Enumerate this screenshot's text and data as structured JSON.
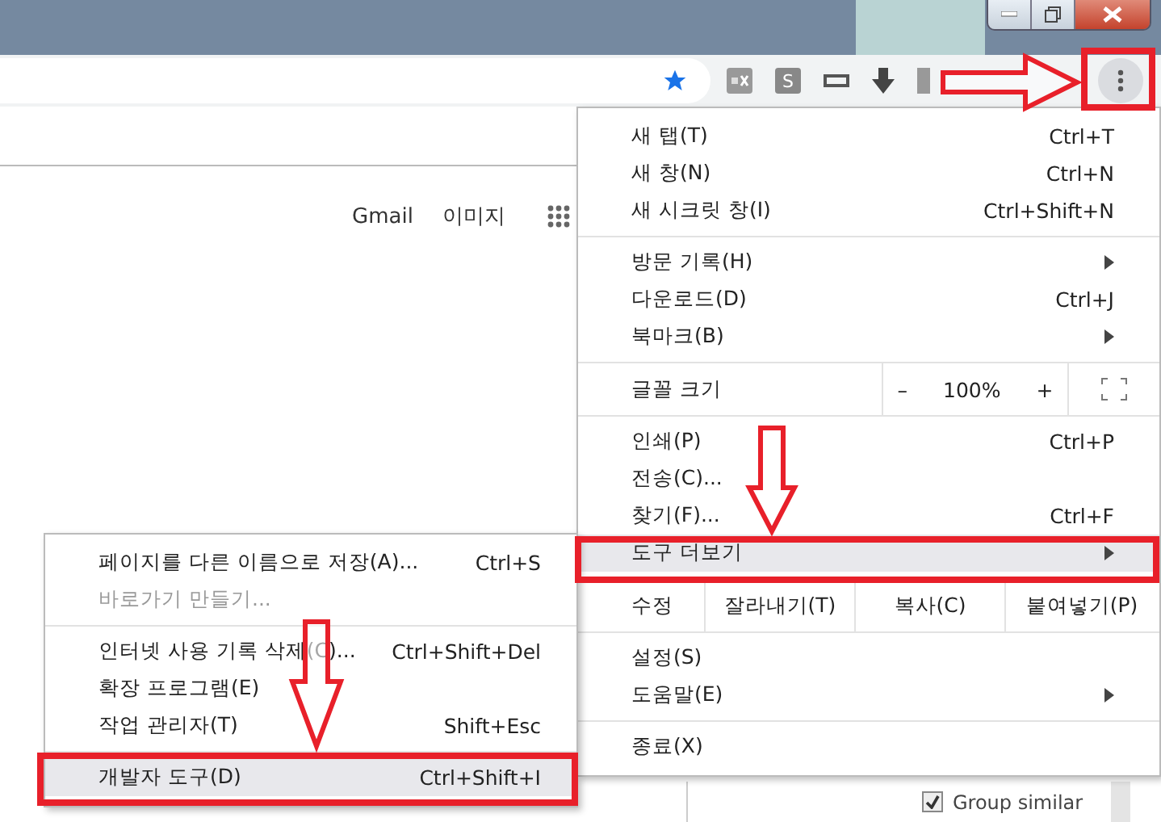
{
  "toolbar": {
    "extension_letter": "S"
  },
  "page_links": [
    "Gmail",
    "이미지"
  ],
  "main_menu": [
    {
      "kind": "item",
      "label": "새 탭(T)",
      "shortcut": "Ctrl+T",
      "selected": false
    },
    {
      "kind": "item",
      "label": "새 창(N)",
      "shortcut": "Ctrl+N",
      "selected": false
    },
    {
      "kind": "item",
      "label": "새 시크릿 창(I)",
      "shortcut": "Ctrl+Shift+N",
      "selected": false
    },
    {
      "kind": "separator"
    },
    {
      "kind": "item",
      "label": "방문 기록(H)",
      "has_submenu": true,
      "selected": false
    },
    {
      "kind": "item",
      "label": "다운로드(D)",
      "shortcut": "Ctrl+J",
      "selected": false
    },
    {
      "kind": "item",
      "label": "북마크(B)",
      "has_submenu": true,
      "selected": false
    },
    {
      "kind": "zoom",
      "label": "글꼴 크기",
      "minus": "–",
      "value": "100%",
      "plus": "+"
    },
    {
      "kind": "item",
      "label": "인쇄(P)",
      "shortcut": "Ctrl+P",
      "selected": false
    },
    {
      "kind": "item",
      "label": "전송(C)...",
      "selected": false
    },
    {
      "kind": "item",
      "label": "찾기(F)...",
      "shortcut": "Ctrl+F",
      "selected": false
    },
    {
      "kind": "item",
      "label": "도구 더보기",
      "has_submenu": true,
      "selected": true
    },
    {
      "kind": "edit",
      "label": "수정",
      "buttons": [
        "잘라내기(T)",
        "복사(C)",
        "붙여넣기(P)"
      ]
    },
    {
      "kind": "item",
      "label": "설정(S)",
      "selected": false
    },
    {
      "kind": "item",
      "label": "도움말(E)",
      "has_submenu": true,
      "selected": false
    },
    {
      "kind": "separator"
    },
    {
      "kind": "item",
      "label": "종료(X)",
      "selected": false
    }
  ],
  "submenu": [
    {
      "kind": "item",
      "label": "페이지를 다른 이름으로 저장(A)...",
      "shortcut": "Ctrl+S",
      "disabled": false,
      "selected": false
    },
    {
      "kind": "item",
      "label": "바로가기 만들기...",
      "disabled": true,
      "selected": false
    },
    {
      "kind": "separator"
    },
    {
      "kind": "item",
      "label": "인터넷 사용 기록 삭제(C)...",
      "shortcut": "Ctrl+Shift+Del",
      "disabled": false,
      "selected": false
    },
    {
      "kind": "item",
      "label": "확장 프로그램(E)",
      "disabled": false,
      "selected": false
    },
    {
      "kind": "item",
      "label": "작업 관리자(T)",
      "shortcut": "Shift+Esc",
      "disabled": false,
      "selected": false
    },
    {
      "kind": "separator"
    },
    {
      "kind": "item",
      "label": "개발자 도구(D)",
      "shortcut": "Ctrl+Shift+I",
      "disabled": false,
      "selected": true
    }
  ],
  "background_option": {
    "label": "Group similar",
    "checked": true
  }
}
